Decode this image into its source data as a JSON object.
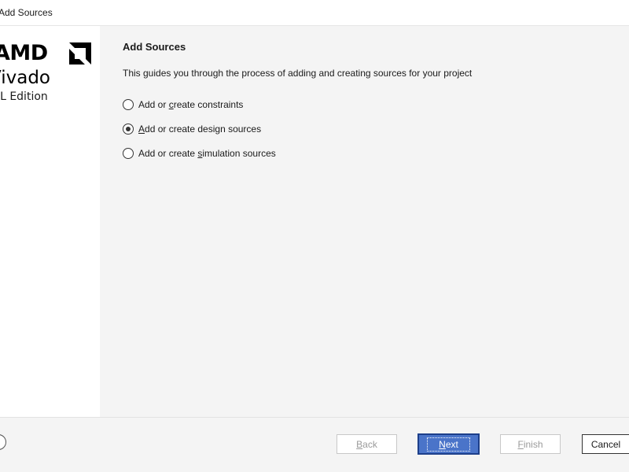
{
  "window": {
    "title": "Add Sources"
  },
  "logo": {
    "brand": "AMD",
    "product": "Vivado",
    "edition": "ML Edition"
  },
  "page": {
    "title": "Add Sources",
    "description": "This guides you through the process of adding and creating sources for your project",
    "options": [
      {
        "pre": "Add or ",
        "mnemonic": "c",
        "post": "reate constraints",
        "selected": false
      },
      {
        "pre": "",
        "mnemonic": "A",
        "post": "dd or create design sources",
        "selected": true
      },
      {
        "pre": "Add or create ",
        "mnemonic": "s",
        "post": "imulation sources",
        "selected": false
      }
    ]
  },
  "footer": {
    "back": {
      "mnemonic": "B",
      "rest": "ack",
      "enabled": false
    },
    "next": {
      "mnemonic": "N",
      "rest": "ext",
      "enabled": true
    },
    "finish": {
      "mnemonic": "F",
      "rest": "inish",
      "enabled": false
    },
    "cancel": {
      "label": "Cancel"
    }
  },
  "colors": {
    "primary_button": "#4a74c9",
    "panel_background": "#f4f4f4"
  }
}
